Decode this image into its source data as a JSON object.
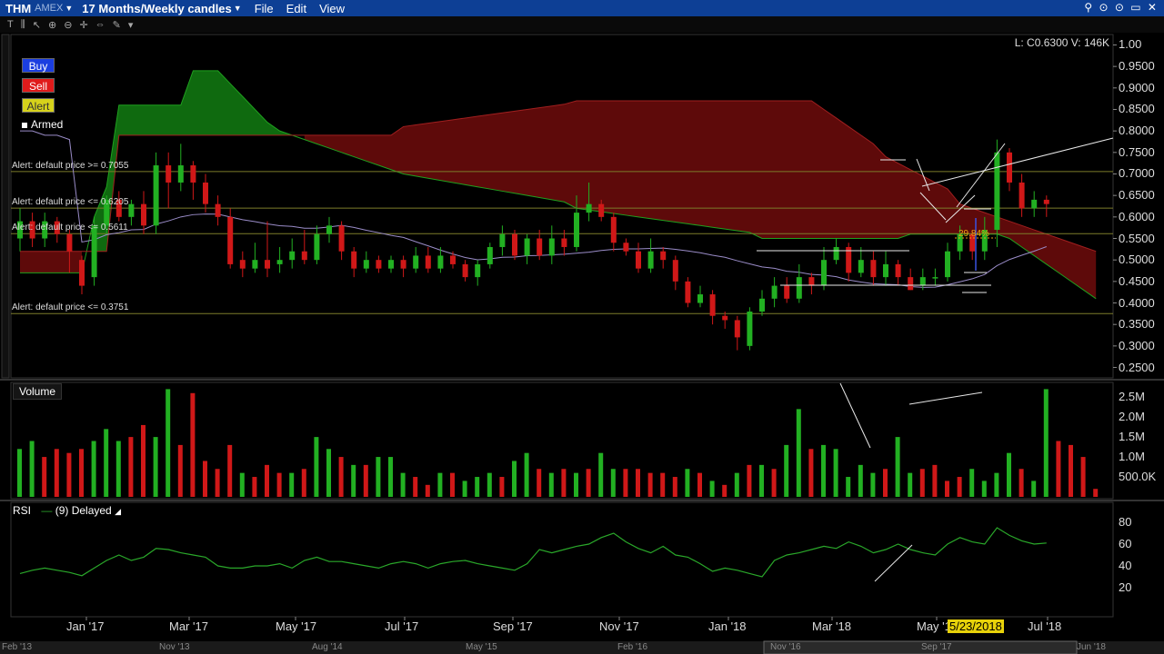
{
  "titlebar": {
    "symbol": "THM",
    "exchange": "AMEX",
    "period": "17 Months/Weekly candles",
    "menus": [
      "File",
      "Edit",
      "View"
    ],
    "controls": "⚲ ⊙ ⊙ ▭ ✕"
  },
  "order_buttons": {
    "buy": "Buy",
    "sell": "Sell",
    "alert": "Alert",
    "armed": "Armed"
  },
  "readout": "L: C0.6300 V: 146K",
  "alerts": [
    {
      "label": "Alert: default price >= 0.7055",
      "price": 0.7055
    },
    {
      "label": "Alert: default price <= 0.6205",
      "price": 0.6205
    },
    {
      "label": "Alert: default price <= 0.5611",
      "price": 0.5611
    },
    {
      "label": "Alert: default price <= 0.3751",
      "price": 0.3751
    }
  ],
  "annotation_pct": "29.84%",
  "price_axis": [
    "1.00",
    "0.9500",
    "0.9000",
    "0.8500",
    "0.8000",
    "0.7500",
    "0.7000",
    "0.6500",
    "0.6000",
    "0.5500",
    "0.5000",
    "0.4500",
    "0.4000",
    "0.3500",
    "0.3000",
    "0.2500"
  ],
  "volume_panel": {
    "title": "Volume",
    "axis": [
      "2.5M",
      "2.0M",
      "1.5M",
      "1.0M",
      "500.0K"
    ]
  },
  "rsi_panel": {
    "title": "RSI",
    "legend": "(9) Delayed",
    "axis": [
      "80",
      "60",
      "40",
      "20"
    ]
  },
  "time_axis": [
    "Jan '17",
    "Mar '17",
    "May '17",
    "Jul '17",
    "Sep '17",
    "Nov '17",
    "Jan '18",
    "Mar '18",
    "May '18",
    "Jul '18"
  ],
  "cursor_date": "5/23/2018",
  "overview_axis": [
    "Feb '13",
    "Nov '13",
    "Aug '14",
    "May '15",
    "Feb '16",
    "Nov '16",
    "Sep '17",
    "Jun '18"
  ],
  "colors": {
    "up": "#22b022",
    "down": "#d01818",
    "cloud_green": "#0f6a0f",
    "cloud_red": "#5e0a0a",
    "ma_line": "#9a8cc8",
    "rsi_line": "#2aa82a",
    "alert_line": "#7c7c2a",
    "title_bar": "#0d3f95"
  },
  "chart_data": {
    "type": "candlestick",
    "price_ylim": [
      0.23,
      1.02
    ],
    "candles": [
      [
        0.55,
        0.59,
        0.52,
        0.62
      ],
      [
        0.59,
        0.55,
        0.53,
        0.61
      ],
      [
        0.55,
        0.59,
        0.53,
        0.61
      ],
      [
        0.59,
        0.56,
        0.54,
        0.6
      ],
      [
        0.56,
        0.52,
        0.47,
        0.57
      ],
      [
        0.5,
        0.44,
        0.42,
        0.51
      ],
      [
        0.46,
        0.58,
        0.44,
        0.6
      ],
      [
        0.58,
        0.64,
        0.56,
        0.65
      ],
      [
        0.64,
        0.6,
        0.59,
        0.66
      ],
      [
        0.6,
        0.63,
        0.58,
        0.64
      ],
      [
        0.63,
        0.58,
        0.56,
        0.66
      ],
      [
        0.58,
        0.72,
        0.56,
        0.75
      ],
      [
        0.72,
        0.68,
        0.62,
        0.75
      ],
      [
        0.68,
        0.72,
        0.66,
        0.77
      ],
      [
        0.72,
        0.68,
        0.64,
        0.73
      ],
      [
        0.68,
        0.63,
        0.61,
        0.7
      ],
      [
        0.63,
        0.6,
        0.58,
        0.65
      ],
      [
        0.6,
        0.49,
        0.48,
        0.62
      ],
      [
        0.5,
        0.48,
        0.46,
        0.52
      ],
      [
        0.48,
        0.5,
        0.47,
        0.54
      ],
      [
        0.5,
        0.48,
        0.46,
        0.59
      ],
      [
        0.49,
        0.5,
        0.47,
        0.53
      ],
      [
        0.5,
        0.52,
        0.48,
        0.55
      ],
      [
        0.52,
        0.5,
        0.49,
        0.57
      ],
      [
        0.5,
        0.56,
        0.49,
        0.58
      ],
      [
        0.56,
        0.58,
        0.54,
        0.6
      ],
      [
        0.58,
        0.52,
        0.5,
        0.59
      ],
      [
        0.52,
        0.48,
        0.46,
        0.53
      ],
      [
        0.48,
        0.5,
        0.47,
        0.52
      ],
      [
        0.5,
        0.48,
        0.47,
        0.51
      ],
      [
        0.48,
        0.5,
        0.47,
        0.51
      ],
      [
        0.5,
        0.48,
        0.46,
        0.51
      ],
      [
        0.48,
        0.51,
        0.47,
        0.53
      ],
      [
        0.51,
        0.48,
        0.47,
        0.53
      ],
      [
        0.48,
        0.51,
        0.47,
        0.53
      ],
      [
        0.51,
        0.49,
        0.48,
        0.52
      ],
      [
        0.49,
        0.46,
        0.45,
        0.5
      ],
      [
        0.46,
        0.49,
        0.44,
        0.5
      ],
      [
        0.49,
        0.53,
        0.48,
        0.54
      ],
      [
        0.53,
        0.56,
        0.51,
        0.58
      ],
      [
        0.56,
        0.51,
        0.5,
        0.57
      ],
      [
        0.51,
        0.55,
        0.49,
        0.56
      ],
      [
        0.55,
        0.51,
        0.5,
        0.57
      ],
      [
        0.51,
        0.55,
        0.49,
        0.58
      ],
      [
        0.55,
        0.53,
        0.51,
        0.57
      ],
      [
        0.53,
        0.61,
        0.52,
        0.65
      ],
      [
        0.61,
        0.63,
        0.59,
        0.68
      ],
      [
        0.63,
        0.6,
        0.59,
        0.64
      ],
      [
        0.6,
        0.54,
        0.52,
        0.61
      ],
      [
        0.54,
        0.52,
        0.51,
        0.55
      ],
      [
        0.52,
        0.48,
        0.47,
        0.54
      ],
      [
        0.48,
        0.52,
        0.47,
        0.55
      ],
      [
        0.52,
        0.5,
        0.48,
        0.53
      ],
      [
        0.5,
        0.45,
        0.43,
        0.51
      ],
      [
        0.45,
        0.4,
        0.39,
        0.46
      ],
      [
        0.4,
        0.42,
        0.39,
        0.44
      ],
      [
        0.42,
        0.37,
        0.35,
        0.43
      ],
      [
        0.37,
        0.36,
        0.34,
        0.38
      ],
      [
        0.36,
        0.32,
        0.29,
        0.37
      ],
      [
        0.3,
        0.38,
        0.29,
        0.39
      ],
      [
        0.38,
        0.41,
        0.37,
        0.43
      ],
      [
        0.41,
        0.44,
        0.39,
        0.46
      ],
      [
        0.44,
        0.41,
        0.4,
        0.46
      ],
      [
        0.41,
        0.46,
        0.4,
        0.49
      ],
      [
        0.46,
        0.44,
        0.42,
        0.47
      ],
      [
        0.44,
        0.5,
        0.43,
        0.53
      ],
      [
        0.5,
        0.53,
        0.49,
        0.55
      ],
      [
        0.53,
        0.47,
        0.45,
        0.54
      ],
      [
        0.47,
        0.5,
        0.46,
        0.53
      ],
      [
        0.5,
        0.46,
        0.44,
        0.52
      ],
      [
        0.46,
        0.49,
        0.44,
        0.52
      ],
      [
        0.49,
        0.46,
        0.44,
        0.5
      ],
      [
        0.46,
        0.43,
        0.43,
        0.48
      ],
      [
        0.44,
        0.46,
        0.43,
        0.48
      ],
      [
        0.46,
        0.46,
        0.44,
        0.48
      ],
      [
        0.46,
        0.52,
        0.45,
        0.54
      ],
      [
        0.52,
        0.56,
        0.5,
        0.58
      ],
      [
        0.56,
        0.52,
        0.5,
        0.57
      ],
      [
        0.52,
        0.57,
        0.5,
        0.6
      ],
      [
        0.57,
        0.75,
        0.53,
        0.78
      ],
      [
        0.75,
        0.68,
        0.66,
        0.76
      ],
      [
        0.68,
        0.62,
        0.6,
        0.7
      ],
      [
        0.62,
        0.64,
        0.6,
        0.66
      ],
      [
        0.64,
        0.63,
        0.6,
        0.65
      ]
    ],
    "volume_ylim": [
      0,
      2.8
    ],
    "volume": [
      [
        1.2,
        "up"
      ],
      [
        1.4,
        "up"
      ],
      [
        1.0,
        "down"
      ],
      [
        1.2,
        "down"
      ],
      [
        1.1,
        "down"
      ],
      [
        1.2,
        "down"
      ],
      [
        1.4,
        "up"
      ],
      [
        1.7,
        "up"
      ],
      [
        1.4,
        "up"
      ],
      [
        1.5,
        "down"
      ],
      [
        1.8,
        "down"
      ],
      [
        1.5,
        "up"
      ],
      [
        2.7,
        "up"
      ],
      [
        1.3,
        "down"
      ],
      [
        2.6,
        "down"
      ],
      [
        0.9,
        "down"
      ],
      [
        0.7,
        "down"
      ],
      [
        1.3,
        "down"
      ],
      [
        0.6,
        "up"
      ],
      [
        0.5,
        "down"
      ],
      [
        0.8,
        "down"
      ],
      [
        0.6,
        "down"
      ],
      [
        0.6,
        "up"
      ],
      [
        0.7,
        "down"
      ],
      [
        1.5,
        "up"
      ],
      [
        1.2,
        "up"
      ],
      [
        1.0,
        "down"
      ],
      [
        0.8,
        "up"
      ],
      [
        0.8,
        "down"
      ],
      [
        1.0,
        "up"
      ],
      [
        1.0,
        "up"
      ],
      [
        0.6,
        "up"
      ],
      [
        0.5,
        "down"
      ],
      [
        0.3,
        "down"
      ],
      [
        0.6,
        "up"
      ],
      [
        0.6,
        "down"
      ],
      [
        0.4,
        "up"
      ],
      [
        0.5,
        "up"
      ],
      [
        0.6,
        "up"
      ],
      [
        0.5,
        "down"
      ],
      [
        0.9,
        "up"
      ],
      [
        1.1,
        "up"
      ],
      [
        0.7,
        "down"
      ],
      [
        0.6,
        "up"
      ],
      [
        0.7,
        "down"
      ],
      [
        0.6,
        "up"
      ],
      [
        0.7,
        "down"
      ],
      [
        1.1,
        "up"
      ],
      [
        0.7,
        "up"
      ],
      [
        0.7,
        "down"
      ],
      [
        0.7,
        "down"
      ],
      [
        0.6,
        "down"
      ],
      [
        0.6,
        "down"
      ],
      [
        0.5,
        "down"
      ],
      [
        0.7,
        "up"
      ],
      [
        0.6,
        "down"
      ],
      [
        0.4,
        "up"
      ],
      [
        0.3,
        "down"
      ],
      [
        0.6,
        "up"
      ],
      [
        0.8,
        "down"
      ],
      [
        0.8,
        "up"
      ],
      [
        0.7,
        "down"
      ],
      [
        1.3,
        "up"
      ],
      [
        2.2,
        "up"
      ],
      [
        1.2,
        "down"
      ],
      [
        1.3,
        "up"
      ],
      [
        1.2,
        "up"
      ],
      [
        0.5,
        "up"
      ],
      [
        0.8,
        "up"
      ],
      [
        0.6,
        "up"
      ],
      [
        0.7,
        "down"
      ],
      [
        1.5,
        "up"
      ],
      [
        0.6,
        "up"
      ],
      [
        0.7,
        "down"
      ],
      [
        0.8,
        "down"
      ],
      [
        0.4,
        "down"
      ],
      [
        0.5,
        "down"
      ],
      [
        0.7,
        "up"
      ],
      [
        0.4,
        "up"
      ],
      [
        0.6,
        "up"
      ],
      [
        1.1,
        "up"
      ],
      [
        0.7,
        "down"
      ],
      [
        0.4,
        "up"
      ],
      [
        2.7,
        "up"
      ],
      [
        1.4,
        "down"
      ],
      [
        1.3,
        "down"
      ],
      [
        1.0,
        "down"
      ],
      [
        0.2,
        "down"
      ]
    ],
    "rsi_ylim": [
      0,
      100
    ],
    "rsi": [
      33,
      36,
      38,
      36,
      34,
      31,
      38,
      45,
      50,
      45,
      48,
      56,
      55,
      52,
      50,
      48,
      40,
      38,
      38,
      40,
      40,
      42,
      38,
      45,
      48,
      44,
      44,
      42,
      40,
      38,
      42,
      44,
      42,
      38,
      42,
      44,
      45,
      42,
      40,
      38,
      36,
      42,
      55,
      52,
      55,
      58,
      60,
      66,
      70,
      62,
      56,
      52,
      58,
      50,
      48,
      42,
      35,
      38,
      36,
      33,
      30,
      45,
      50,
      52,
      55,
      58,
      56,
      62,
      58,
      52,
      55,
      60,
      55,
      52,
      50,
      60,
      66,
      62,
      60,
      75,
      68,
      63,
      60,
      61
    ]
  }
}
